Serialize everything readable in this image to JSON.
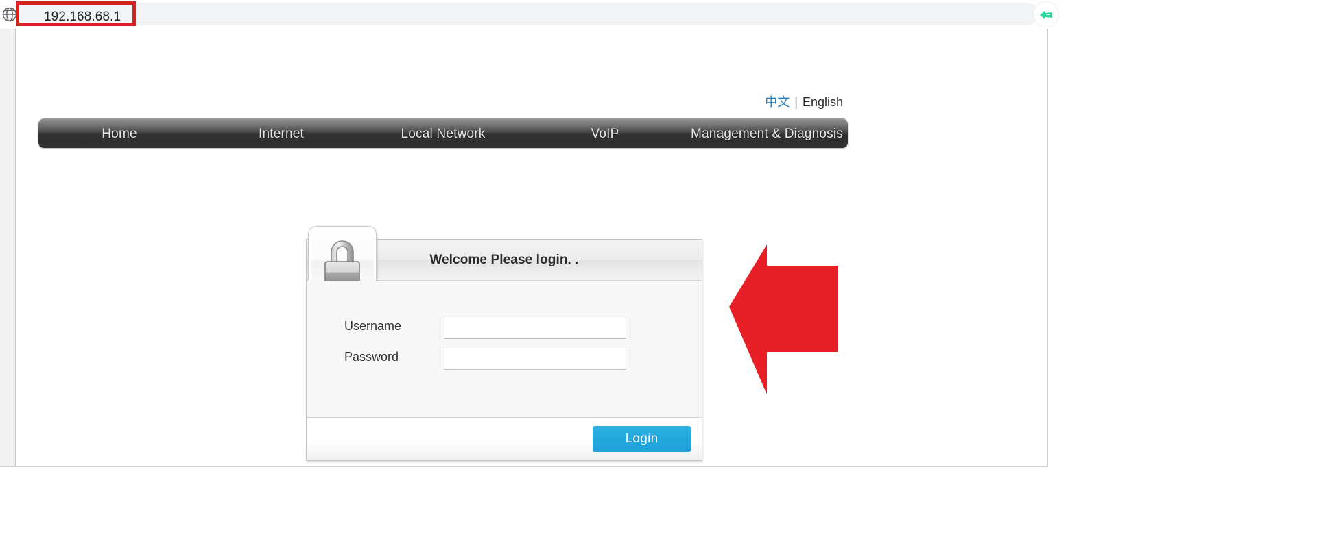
{
  "browser": {
    "url_value": "192.168.68.1",
    "globe_icon": "globe-icon",
    "extension_icon": "extension-green-icon",
    "highlight_color": "#d92121"
  },
  "page": {
    "language": {
      "chinese_label": "中文",
      "separator": "|",
      "english_label": "English",
      "chinese_color": "#2a7cb8"
    },
    "nav": {
      "items": [
        {
          "label": "Home"
        },
        {
          "label": "Internet"
        },
        {
          "label": "Local Network"
        },
        {
          "label": "VoIP"
        },
        {
          "label": "Management & Diagnosis"
        }
      ]
    },
    "login_card": {
      "lock_icon": "padlock-icon",
      "title": "Welcome Please login. .",
      "fields": [
        {
          "label": "Username",
          "value": "",
          "placeholder": "",
          "type": "text",
          "name": "username"
        },
        {
          "label": "Password",
          "value": "",
          "placeholder": "",
          "type": "password",
          "name": "password"
        }
      ],
      "submit_label": "Login",
      "submit_color": "#23a8dd"
    },
    "annotation": {
      "arrow_icon": "left-arrow-annotation",
      "arrow_color": "#e81f26"
    }
  }
}
